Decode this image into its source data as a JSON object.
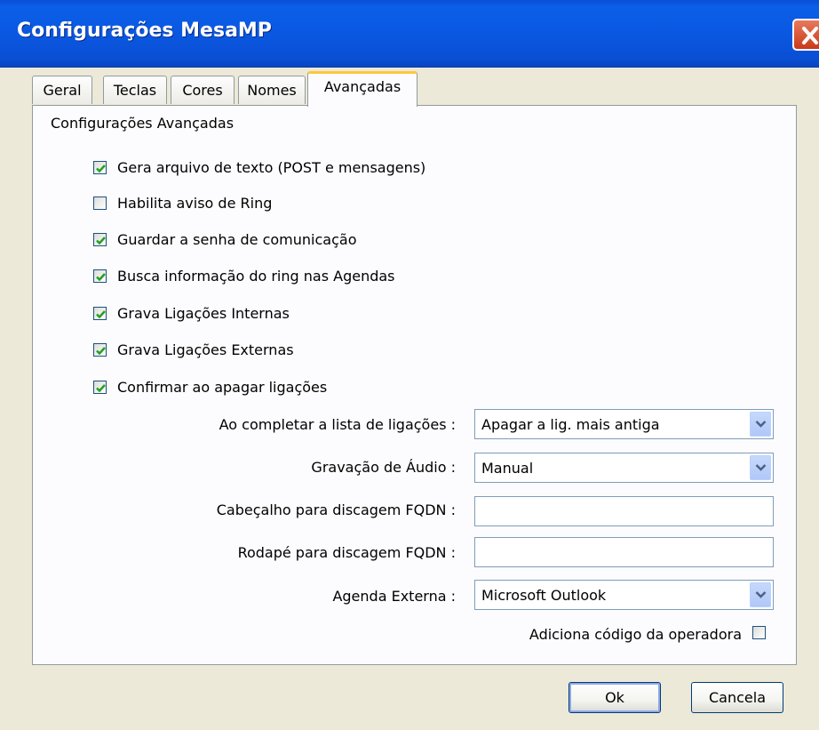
{
  "window": {
    "title": "Configurações MesaMP"
  },
  "tabs": [
    {
      "label": "Geral"
    },
    {
      "label": "Teclas"
    },
    {
      "label": "Cores"
    },
    {
      "label": "Nomes"
    },
    {
      "label": "Avançadas",
      "active": true
    }
  ],
  "panel": {
    "section_title": "Configurações Avançadas",
    "checkboxes": [
      {
        "label": "Gera arquivo de texto (POST e mensagens)",
        "checked": true
      },
      {
        "label": "Habilita aviso de Ring",
        "checked": false
      },
      {
        "label": "Guardar a senha de comunicação",
        "checked": true
      },
      {
        "label": "Busca informação do ring nas Agendas",
        "checked": true
      },
      {
        "label": "Grava Ligações Internas",
        "checked": true
      },
      {
        "label": "Grava Ligações Externas",
        "checked": true
      },
      {
        "label": "Confirmar ao apagar ligações",
        "checked": true
      }
    ],
    "fields": {
      "lista_label": "Ao completar a lista de ligações :",
      "lista_value": "Apagar a lig. mais antiga",
      "audio_label": "Gravação de Áudio :",
      "audio_value": "Manual",
      "cabecalho_label": "Cabeçalho para discagem FQDN :",
      "cabecalho_value": "",
      "rodape_label": "Rodapé para discagem FQDN :",
      "rodape_value": "",
      "agenda_label": "Agenda Externa :",
      "agenda_value": "Microsoft Outlook",
      "operadora_label": "Adiciona código da operadora",
      "operadora_checked": false
    }
  },
  "buttons": {
    "ok": "Ok",
    "cancel": "Cancela"
  },
  "colors": {
    "title_bar": "#0a58e2",
    "dialog_bg": "#ece9d8",
    "panel_bg": "#fcfcfe",
    "check_mark": "#21a121",
    "active_tab_accent": "#ffc73c"
  }
}
